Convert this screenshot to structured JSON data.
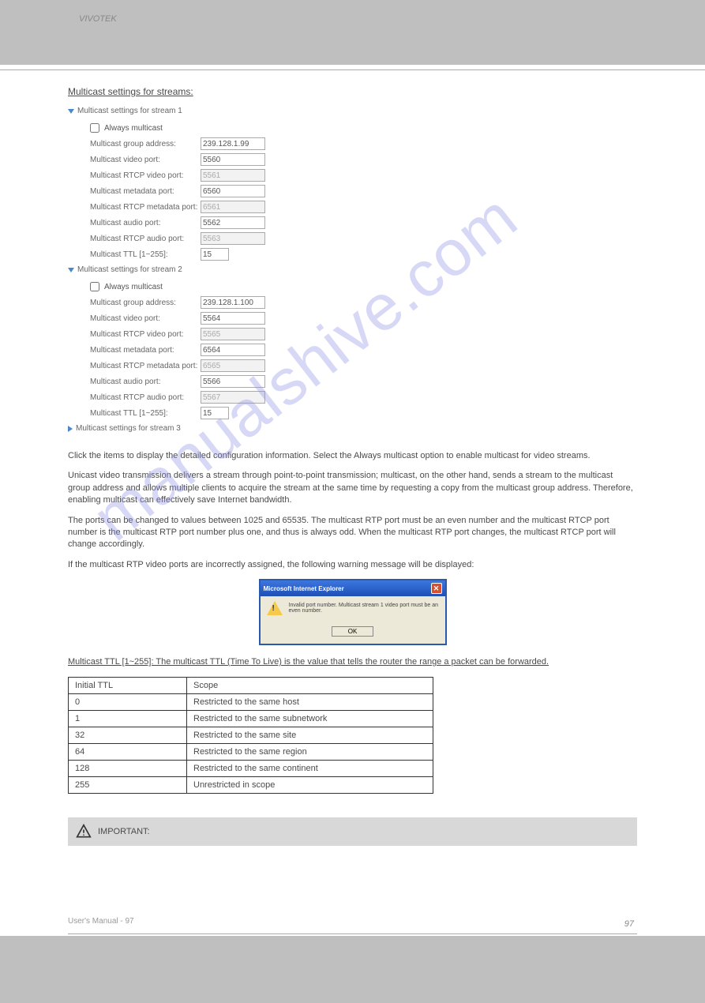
{
  "header": {
    "label": "VIVOTEK"
  },
  "watermark": "manualshive.com",
  "section_title": "Multicast settings for streams:",
  "stream1": {
    "title": "Multicast settings for stream 1",
    "always": "Always multicast",
    "fields": [
      {
        "label": "Multicast group address:",
        "value": "239.128.1.99",
        "disabled": false
      },
      {
        "label": "Multicast video port:",
        "value": "5560",
        "disabled": false
      },
      {
        "label": "Multicast RTCP video port:",
        "value": "5561",
        "disabled": true
      },
      {
        "label": "Multicast metadata port:",
        "value": "6560",
        "disabled": false
      },
      {
        "label": "Multicast RTCP metadata port:",
        "value": "6561",
        "disabled": true
      },
      {
        "label": "Multicast audio port:",
        "value": "5562",
        "disabled": false
      },
      {
        "label": "Multicast RTCP audio port:",
        "value": "5563",
        "disabled": true
      },
      {
        "label": "Multicast TTL [1~255]:",
        "value": "15",
        "disabled": false
      }
    ]
  },
  "stream2": {
    "title": "Multicast settings for stream 2",
    "always": "Always multicast",
    "fields": [
      {
        "label": "Multicast group address:",
        "value": "239.128.1.100",
        "disabled": false
      },
      {
        "label": "Multicast video port:",
        "value": "5564",
        "disabled": false
      },
      {
        "label": "Multicast RTCP video port:",
        "value": "5565",
        "disabled": true
      },
      {
        "label": "Multicast metadata port:",
        "value": "6564",
        "disabled": false
      },
      {
        "label": "Multicast RTCP metadata port:",
        "value": "6565",
        "disabled": true
      },
      {
        "label": "Multicast audio port:",
        "value": "5566",
        "disabled": false
      },
      {
        "label": "Multicast RTCP audio port:",
        "value": "5567",
        "disabled": true
      },
      {
        "label": "Multicast TTL [1~255]:",
        "value": "15",
        "disabled": false
      }
    ]
  },
  "stream3": {
    "title": "Multicast settings for stream 3"
  },
  "body": {
    "p1": "Click the items to display the detailed configuration information. Select the Always multicast option to enable multicast for video streams.",
    "p2": "Unicast video transmission delivers a stream through point-to-point transmission; multicast, on the other hand, sends a stream to the multicast group address and allows multiple clients to acquire the stream at the same time by requesting a copy from the multicast group address. Therefore, enabling multicast can effectively save Internet bandwidth.",
    "p3": "The ports can be changed to values between 1025 and 65535. The multicast RTP port must be an even number and the multicast RTCP port number is the multicast RTP port number plus one, and thus is always odd. When the multicast RTP port changes, the multicast RTCP port will change accordingly.",
    "p4": "If the multicast RTP video ports are incorrectly assigned, the following warning message will be displayed:",
    "p5": "Multicast TTL [1~255]: The multicast TTL (Time To Live) is the value that tells the router the range a packet can be forwarded."
  },
  "dialog": {
    "title": "Microsoft Internet Explorer",
    "message": "Invalid port number. Multicast stream 1 video port must be an even number.",
    "ok": "OK"
  },
  "table": {
    "h1": "Initial TTL",
    "h2": "Scope",
    "rows": [
      [
        "0",
        "Restricted to the same host"
      ],
      [
        "1",
        "Restricted to the same subnetwork"
      ],
      [
        "32",
        "Restricted to the same site"
      ],
      [
        "64",
        "Restricted to the same region"
      ],
      [
        "128",
        "Restricted to the same continent"
      ],
      [
        "255",
        "Unrestricted in scope"
      ]
    ]
  },
  "note": "IMPORTANT:",
  "footer": {
    "text": "User's Manual - 97",
    "pagenum": "97"
  }
}
